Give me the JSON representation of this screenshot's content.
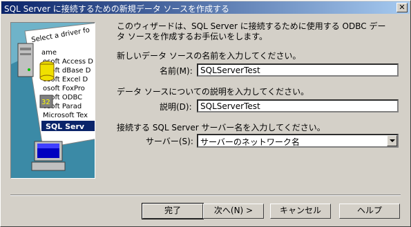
{
  "window": {
    "title": "SQL Server に接続するための新規データ ソースを作成する",
    "close_glyph": "✕"
  },
  "illustration": {
    "header": "Select a driver fo",
    "drivers": [
      "ame",
      "osoft Access D",
      "osoft dBase D",
      "osoft Excel D",
      "osoft FoxPro",
      "osoft ODBC",
      "osoft Parad",
      "Microsoft Tex",
      "SQL Serv"
    ],
    "selected_driver": "SQL Serv",
    "badge": "32"
  },
  "intro_text": "このウィザードは、SQL Server に接続するために使用する ODBC データ ソースを作成するお手伝いをします。",
  "name_section": {
    "prompt": "新しいデータ ソースの名前を入力してください。",
    "label": "名前(M):",
    "value": "SQLServerTest"
  },
  "desc_section": {
    "prompt": "データ ソースについての説明を入力してください。",
    "label": "説明(D):",
    "value": "SQLServerTest"
  },
  "server_section": {
    "prompt": "接続する SQL Server サーバー名を入力してください。",
    "label": "サーバー(S):",
    "value": "サーバーのネットワーク名"
  },
  "buttons": {
    "finish": "完了",
    "next": "次へ(N) >",
    "cancel": "キャンセル",
    "help": "ヘルプ"
  }
}
